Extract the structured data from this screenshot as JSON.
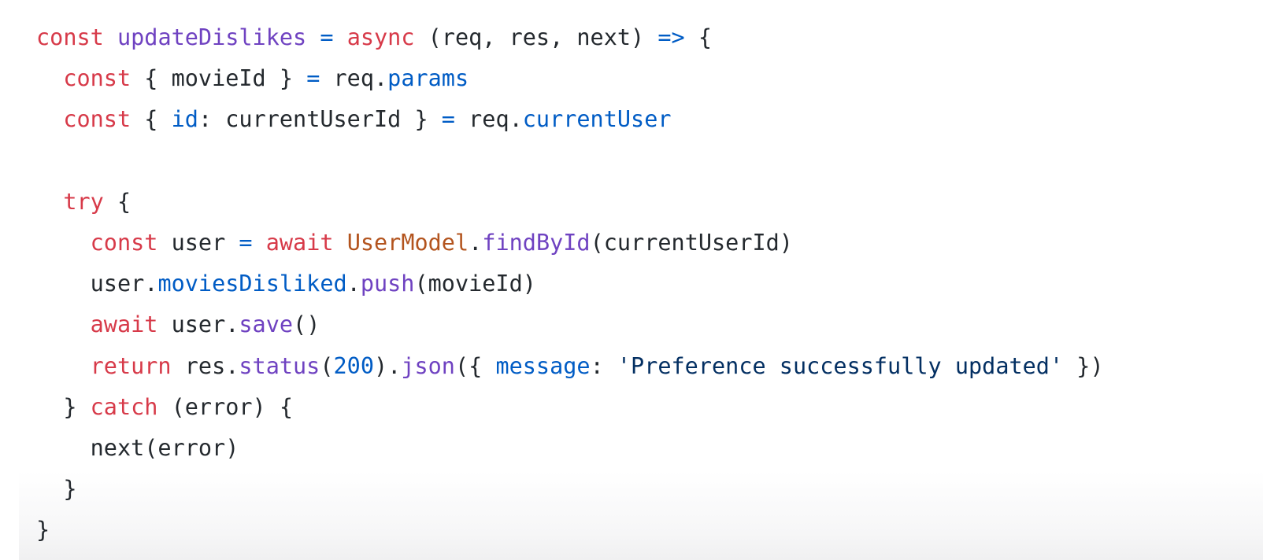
{
  "colors": {
    "keyword": "#d73a49",
    "function": "#6f42c1",
    "property": "#005cc5",
    "class": "#b3541e",
    "string": "#032f62",
    "number": "#005cc5",
    "operator": "#005cc5",
    "plain": "#24292e",
    "background": "#ffffff"
  },
  "code_lines": [
    {
      "tokens": [
        {
          "text": "const",
          "type": "keyword"
        },
        {
          "text": " ",
          "type": "plain"
        },
        {
          "text": "updateDislikes",
          "type": "function"
        },
        {
          "text": " ",
          "type": "plain"
        },
        {
          "text": "=",
          "type": "operator"
        },
        {
          "text": " ",
          "type": "plain"
        },
        {
          "text": "async",
          "type": "keyword"
        },
        {
          "text": " (req, res, next) ",
          "type": "plain"
        },
        {
          "text": "=>",
          "type": "operator"
        },
        {
          "text": " {",
          "type": "plain"
        }
      ]
    },
    {
      "tokens": [
        {
          "text": "  ",
          "type": "plain"
        },
        {
          "text": "const",
          "type": "keyword"
        },
        {
          "text": " { movieId } ",
          "type": "plain"
        },
        {
          "text": "=",
          "type": "operator"
        },
        {
          "text": " req.",
          "type": "plain"
        },
        {
          "text": "params",
          "type": "property"
        }
      ]
    },
    {
      "tokens": [
        {
          "text": "  ",
          "type": "plain"
        },
        {
          "text": "const",
          "type": "keyword"
        },
        {
          "text": " { ",
          "type": "plain"
        },
        {
          "text": "id",
          "type": "property"
        },
        {
          "text": ": currentUserId } ",
          "type": "plain"
        },
        {
          "text": "=",
          "type": "operator"
        },
        {
          "text": " req.",
          "type": "plain"
        },
        {
          "text": "currentUser",
          "type": "property"
        }
      ]
    },
    {
      "tokens": []
    },
    {
      "tokens": [
        {
          "text": "  ",
          "type": "plain"
        },
        {
          "text": "try",
          "type": "keyword"
        },
        {
          "text": " {",
          "type": "plain"
        }
      ]
    },
    {
      "tokens": [
        {
          "text": "    ",
          "type": "plain"
        },
        {
          "text": "const",
          "type": "keyword"
        },
        {
          "text": " user ",
          "type": "plain"
        },
        {
          "text": "=",
          "type": "operator"
        },
        {
          "text": " ",
          "type": "plain"
        },
        {
          "text": "await",
          "type": "keyword"
        },
        {
          "text": " ",
          "type": "plain"
        },
        {
          "text": "UserModel",
          "type": "class"
        },
        {
          "text": ".",
          "type": "plain"
        },
        {
          "text": "findById",
          "type": "function"
        },
        {
          "text": "(currentUserId)",
          "type": "plain"
        }
      ]
    },
    {
      "tokens": [
        {
          "text": "    user.",
          "type": "plain"
        },
        {
          "text": "moviesDisliked",
          "type": "property"
        },
        {
          "text": ".",
          "type": "plain"
        },
        {
          "text": "push",
          "type": "function"
        },
        {
          "text": "(movieId)",
          "type": "plain"
        }
      ]
    },
    {
      "tokens": [
        {
          "text": "    ",
          "type": "plain"
        },
        {
          "text": "await",
          "type": "keyword"
        },
        {
          "text": " user.",
          "type": "plain"
        },
        {
          "text": "save",
          "type": "function"
        },
        {
          "text": "()",
          "type": "plain"
        }
      ]
    },
    {
      "tokens": [
        {
          "text": "    ",
          "type": "plain"
        },
        {
          "text": "return",
          "type": "keyword"
        },
        {
          "text": " res.",
          "type": "plain"
        },
        {
          "text": "status",
          "type": "function"
        },
        {
          "text": "(",
          "type": "plain"
        },
        {
          "text": "200",
          "type": "number"
        },
        {
          "text": ").",
          "type": "plain"
        },
        {
          "text": "json",
          "type": "function"
        },
        {
          "text": "({ ",
          "type": "plain"
        },
        {
          "text": "message",
          "type": "property"
        },
        {
          "text": ": ",
          "type": "plain"
        },
        {
          "text": "'Preference successfully updated'",
          "type": "string"
        },
        {
          "text": " })",
          "type": "plain"
        }
      ]
    },
    {
      "tokens": [
        {
          "text": "  } ",
          "type": "plain"
        },
        {
          "text": "catch",
          "type": "keyword"
        },
        {
          "text": " (error) {",
          "type": "plain"
        }
      ]
    },
    {
      "tokens": [
        {
          "text": "    next(error)",
          "type": "plain"
        }
      ]
    },
    {
      "tokens": [
        {
          "text": "  }",
          "type": "plain"
        }
      ]
    },
    {
      "tokens": [
        {
          "text": "}",
          "type": "plain"
        }
      ]
    }
  ]
}
